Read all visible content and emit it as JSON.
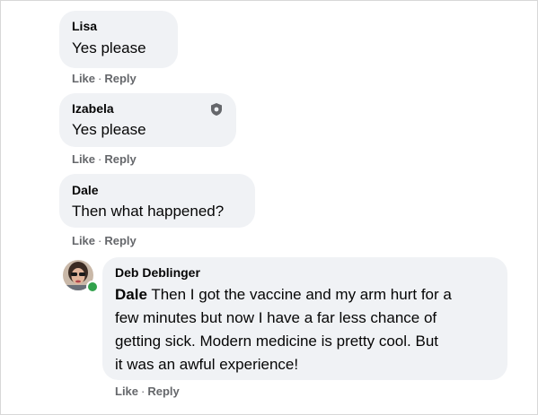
{
  "comments": [
    {
      "author": "Lisa",
      "text": "Yes please",
      "actions": {
        "like": "Like",
        "reply": "Reply"
      }
    },
    {
      "author": "Izabela",
      "text": "Yes please",
      "badge_icon": "shield-icon",
      "actions": {
        "like": "Like",
        "reply": "Reply"
      }
    },
    {
      "author": "Dale",
      "text": "Then what happened?",
      "actions": {
        "like": "Like",
        "reply": "Reply"
      }
    },
    {
      "author": "Deb Deblinger",
      "mention": "Dale",
      "text_lines": [
        " Then I got the vaccine and my arm hurt for a",
        "few minutes but now I have a far less chance of",
        "getting sick. Modern medicine is pretty cool. But",
        "it was an awful experience!"
      ],
      "online_status_color": "#31a24c",
      "actions": {
        "like": "Like",
        "reply": "Reply"
      }
    }
  ],
  "colors": {
    "bubble": "#f0f2f5",
    "action_text": "#65676b",
    "text": "#050505"
  }
}
